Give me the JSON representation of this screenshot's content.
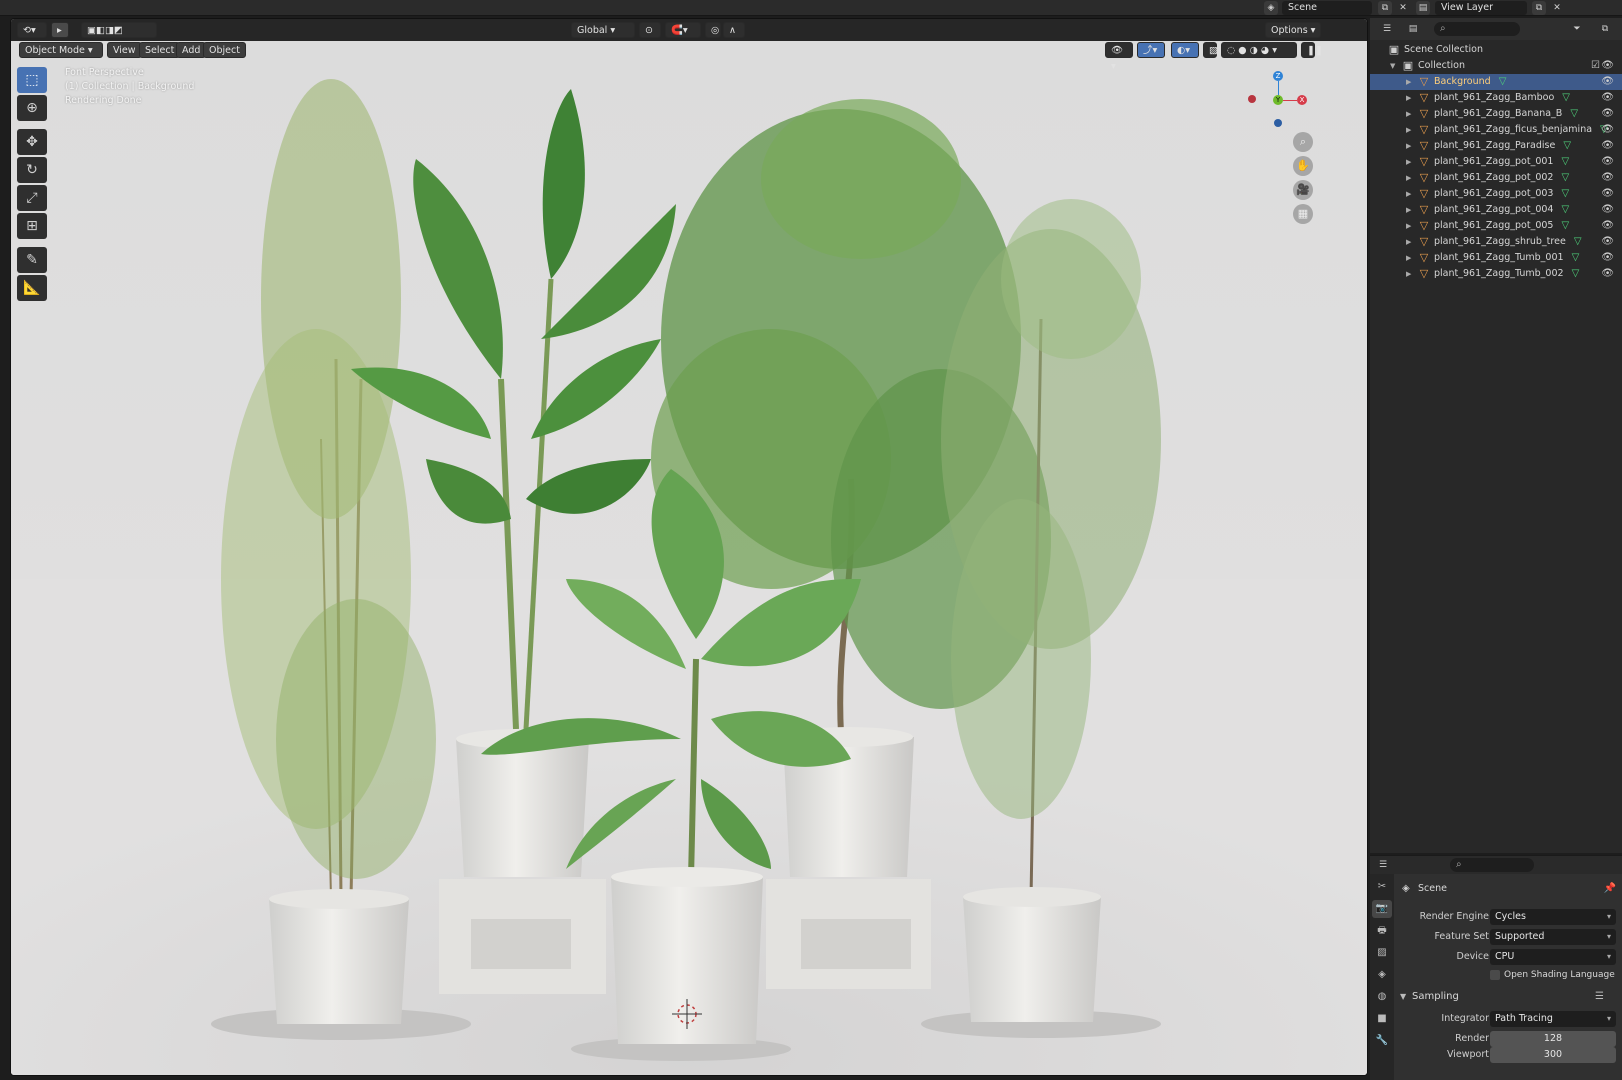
{
  "topbar": {
    "scene_label": "Scene",
    "view_layer_label": "View Layer"
  },
  "viewport": {
    "mode": "Object Mode",
    "menus": [
      "View",
      "Select",
      "Add",
      "Object"
    ],
    "orientation": "Global",
    "options_label": "Options",
    "overlay": {
      "line1": "Font Perspective",
      "line2": "(1) Collection | Background",
      "line3": "Rendering Done"
    },
    "gizmo": {
      "z": "Z",
      "y": "Y",
      "x": "X"
    }
  },
  "outliner": {
    "root": "Scene Collection",
    "collection": "Collection",
    "items": [
      {
        "label": "Background",
        "selected": true
      },
      {
        "label": "plant_961_Zagg_Bamboo",
        "selected": false
      },
      {
        "label": "plant_961_Zagg_Banana_B",
        "selected": false
      },
      {
        "label": "plant_961_Zagg_ficus_benjamina",
        "selected": false
      },
      {
        "label": "plant_961_Zagg_Paradise",
        "selected": false
      },
      {
        "label": "plant_961_Zagg_pot_001",
        "selected": false
      },
      {
        "label": "plant_961_Zagg_pot_002",
        "selected": false
      },
      {
        "label": "plant_961_Zagg_pot_003",
        "selected": false
      },
      {
        "label": "plant_961_Zagg_pot_004",
        "selected": false
      },
      {
        "label": "plant_961_Zagg_pot_005",
        "selected": false
      },
      {
        "label": "plant_961_Zagg_shrub_tree",
        "selected": false
      },
      {
        "label": "plant_961_Zagg_Tumb_001",
        "selected": false
      },
      {
        "label": "plant_961_Zagg_Tumb_002",
        "selected": false
      }
    ]
  },
  "properties": {
    "context": "Scene",
    "render_engine_label": "Render Engine",
    "render_engine_value": "Cycles",
    "feature_set_label": "Feature Set",
    "feature_set_value": "Supported",
    "device_label": "Device",
    "device_value": "CPU",
    "osl_label": "Open Shading Language",
    "sampling_label": "Sampling",
    "integrator_label": "Integrator",
    "integrator_value": "Path Tracing",
    "render_label": "Render",
    "render_value": "128",
    "viewport_label": "Viewport",
    "viewport_value": "300"
  },
  "colors": {
    "selection": "#3e5a8a",
    "active_tool": "#4772b3",
    "mesh_icon": "#4ed27b",
    "object_icon": "#e49b4e"
  }
}
